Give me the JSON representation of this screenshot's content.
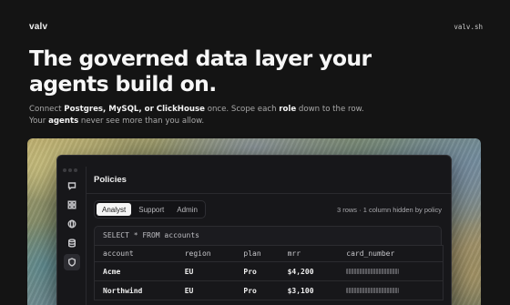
{
  "header": {
    "brand": "valv",
    "site": "valv.sh"
  },
  "hero": {
    "title": "The governed data layer your agents build on.",
    "line1": {
      "a": "Connect ",
      "b": "Postgres, MySQL, or ClickHouse",
      "c": " once. Scope each ",
      "d": "role",
      "e": " down to the row."
    },
    "line2": {
      "a": "Your ",
      "b": "agents",
      "c": " never see more than you allow."
    }
  },
  "app": {
    "panel_title": "Policies",
    "sidebar_icons": [
      "chat-icon",
      "grid-icon",
      "globe-icon",
      "database-icon",
      "shield-icon"
    ],
    "active_sidebar_index": 4,
    "tabs": [
      {
        "label": "Analyst",
        "active": true
      },
      {
        "label": "Support",
        "active": false
      },
      {
        "label": "Admin",
        "active": false
      }
    ],
    "hint": "3 rows · 1 column hidden by policy",
    "query": "SELECT * FROM accounts",
    "columns": [
      "account",
      "region",
      "plan",
      "mrr",
      "card_number"
    ],
    "rows": [
      [
        "Acme",
        "EU",
        "Pro",
        "$4,200",
        ""
      ],
      [
        "Northwind",
        "EU",
        "Pro",
        "$3,100",
        ""
      ]
    ],
    "masked_column": "card_number"
  }
}
